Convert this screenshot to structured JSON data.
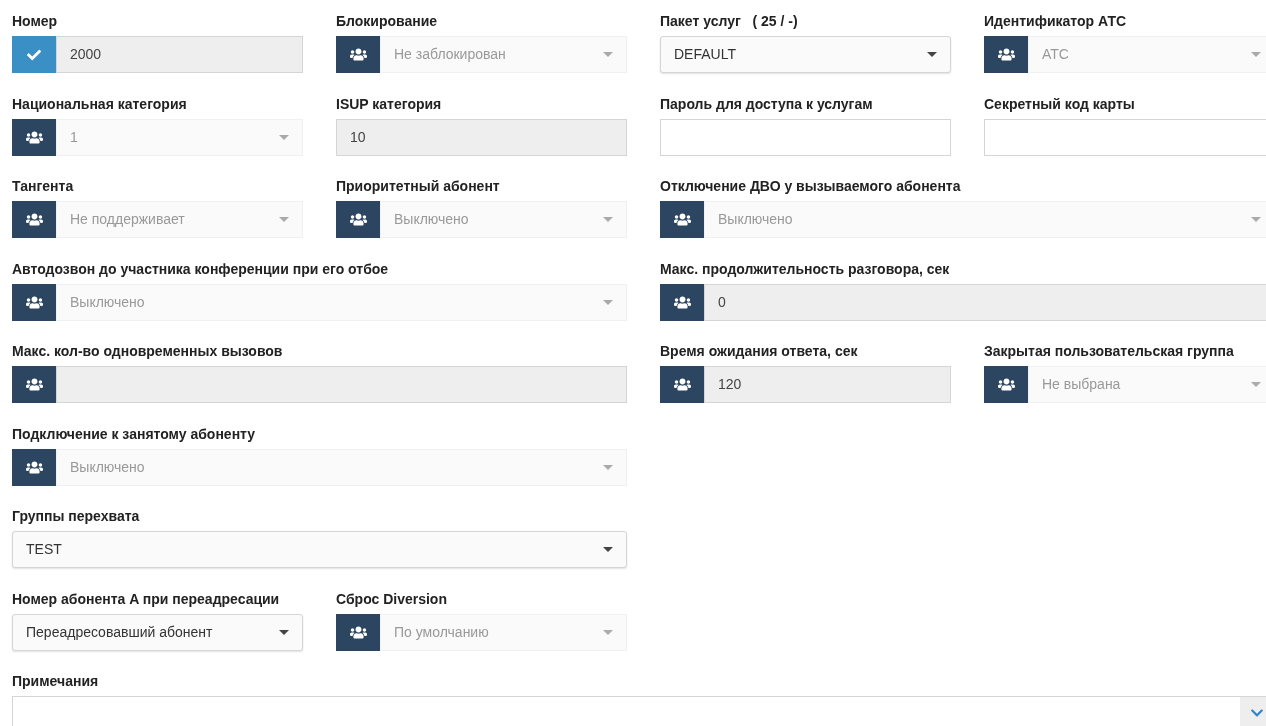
{
  "fields": [
    {
      "label": "Номер",
      "kind": "checkinput",
      "readonly": true,
      "value": "2000"
    },
    {
      "label": "Блокирование",
      "kind": "groupselect",
      "disabled": true,
      "value": "Не заблокирован"
    },
    {
      "label": "Пакет услуг   ( 25 / -)",
      "kind": "select",
      "disabled": false,
      "value": "DEFAULT"
    },
    {
      "label": "Идентификатор АТС",
      "kind": "groupselect",
      "disabled": true,
      "value": "АТС"
    },
    {
      "label": "Национальная категория",
      "kind": "groupselect",
      "disabled": true,
      "value": "1"
    },
    {
      "label": "ISUP категория",
      "kind": "input",
      "readonly": true,
      "value": "10"
    },
    {
      "label": "Пароль для доступа к услугам",
      "kind": "input",
      "readonly": false
    },
    {
      "label": "Секретный код карты",
      "kind": "input",
      "readonly": false
    },
    {
      "label": "Тангента",
      "kind": "groupselect",
      "disabled": true,
      "value": "Не поддерживает"
    },
    {
      "label": "Приоритетный абонент",
      "kind": "groupselect",
      "disabled": true,
      "value": "Выключено"
    },
    {
      "label": "Отключение ДВО у вызываемого абонента",
      "kind": "groupselect",
      "disabled": true,
      "value": "Выключено"
    },
    {
      "label": "Автодозвон до участника конференции при его отбое",
      "kind": "groupselect",
      "disabled": true,
      "value": "Выключено"
    },
    {
      "label": "Макс. продолжительность разговора, сек",
      "kind": "groupinput",
      "readonly": true,
      "value": "0"
    },
    {
      "label": "Макс. кол-во одновременных вызовов",
      "kind": "groupinput",
      "readonly": true
    },
    {
      "label": "Время ожидания ответа, сек",
      "kind": "groupinput",
      "readonly": true,
      "value": "120"
    },
    {
      "label": "Закрытая пользовательская группа",
      "kind": "groupselect",
      "disabled": true,
      "value": "Не выбрана"
    },
    {
      "label": "Подключение к занятому абоненту",
      "kind": "groupselect",
      "disabled": true,
      "value": "Выключено"
    },
    {
      "label": "Группы перехвата",
      "kind": "select",
      "disabled": false,
      "value": "TEST"
    },
    {
      "label": "Номер абонента A при переадресации",
      "kind": "select",
      "disabled": false,
      "value": "Переадресовавший абонент"
    },
    {
      "label": "Сброс Diversion",
      "kind": "groupselect",
      "disabled": true,
      "value": "По умолчанию"
    },
    {
      "label": "Примечания",
      "kind": "textarea"
    }
  ]
}
